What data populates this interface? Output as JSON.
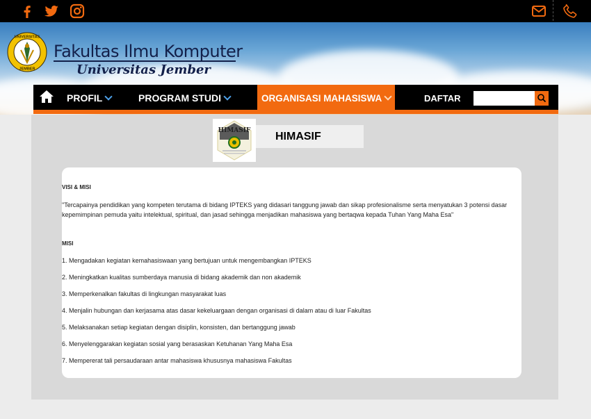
{
  "topbar": {
    "icons": [
      "facebook-icon",
      "twitter-icon",
      "instagram-icon",
      "mail-icon",
      "phone-icon"
    ]
  },
  "header": {
    "logo_text_top": "UNIVERSITAS",
    "logo_text_bottom": "JEMBER",
    "title": "Fakultas Ilmu Komputer",
    "subtitle": "Universitas Jember"
  },
  "nav": {
    "items": [
      {
        "label": "PROFIL"
      },
      {
        "label": "PROGRAM STUDI"
      },
      {
        "label": "ORGANISASI MAHASISWA"
      },
      {
        "label": "DAFTAR"
      }
    ],
    "search_placeholder": ""
  },
  "org": {
    "logo_text": "HIMASIF",
    "name": "HIMASIF"
  },
  "content": {
    "visi_heading": "VISI & MISI",
    "visi_text": "\"Tercapainya pendidikan yang kompeten terutama di bidang IPTEKS yang didasari tanggung jawab dan sikap profesionalisme serta menyatukan 3 potensi dasar kepemimpinan pemuda yaitu intelektual, spiritual, dan jasad sehingga menjadikan mahasiswa yang bertaqwa kepada Tuhan Yang Maha Esa\"",
    "misi_heading": "MISI",
    "misi": [
      "1. Mengadakan kegiatan kemahasiswaan yang bertujuan untuk mengembangkan IPTEKS",
      "2. Meningkatkan kualitas sumberdaya manusia di bidang akademik dan non akademik",
      "3. Memperkenalkan fakultas di lingkungan masyarakat luas",
      "4. Menjalin hubungan dan kerjasama atas dasar kekeluargaan dengan organisasi di dalam atau di luar Fakultas",
      "5. Melaksanakan setiap kegiatan dengan disiplin, konsisten, dan bertanggung jawab",
      "6. Menyelenggarakan kegiatan sosial yang berasaskan Ketuhanan Yang Maha Esa",
      "7. Mempererat tali persaudaraan antar mahasiswa khususnya mahasiswa Fakultas"
    ]
  },
  "colors": {
    "accent": "#f26a10",
    "nav_bg": "#000000",
    "title": "#13204a"
  }
}
